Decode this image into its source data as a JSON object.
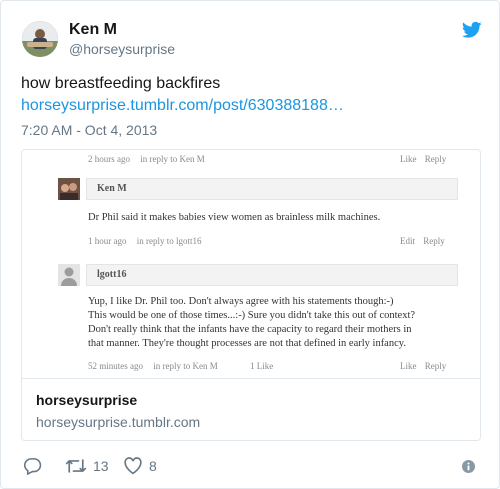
{
  "author": {
    "name": "Ken M",
    "handle": "@horseysurprise"
  },
  "tweet": {
    "text": "how breastfeeding backfires",
    "link": "horseysurprise.tumblr.com/post/630388188…",
    "timestamp": "7:20 AM - Oct 4, 2013"
  },
  "card": {
    "screenshot": {
      "top_meta": {
        "time": "2 hours ago",
        "reply": "in reply to Ken M",
        "actions": "Like  Reply"
      },
      "comment1": {
        "author": "Ken M",
        "body": "Dr Phil said it makes babies view women as brainless milk machines.",
        "time": "1 hour ago",
        "reply": "in reply to lgott16",
        "actions": "Edit  Reply"
      },
      "comment2": {
        "author": "lgott16",
        "line1": "Yup, I like Dr. Phil too. Don't always agree with his statements though:-)",
        "line2": "This would be one of those times...:-) Sure you didn't take this out of context?",
        "line3": "Don't really think that the infants have the capacity to regard their mothers in",
        "line4": "that manner.  They're thought processes are not that defined in early infancy.",
        "time": "52 minutes ago",
        "reply": "in reply to Ken M",
        "likes": "1 Like",
        "actions": "Like  Reply"
      }
    },
    "title": "horseysurprise",
    "domain": "horseysurprise.tumblr.com"
  },
  "actions": {
    "retweets": "13",
    "likes": "8"
  },
  "colors": {
    "link": "#1b95e0",
    "secondary_text": "#657786",
    "border": "#e1e8ed"
  },
  "icons": [
    "twitter-bird-icon",
    "reply-icon",
    "retweet-icon",
    "heart-icon",
    "info-icon"
  ]
}
